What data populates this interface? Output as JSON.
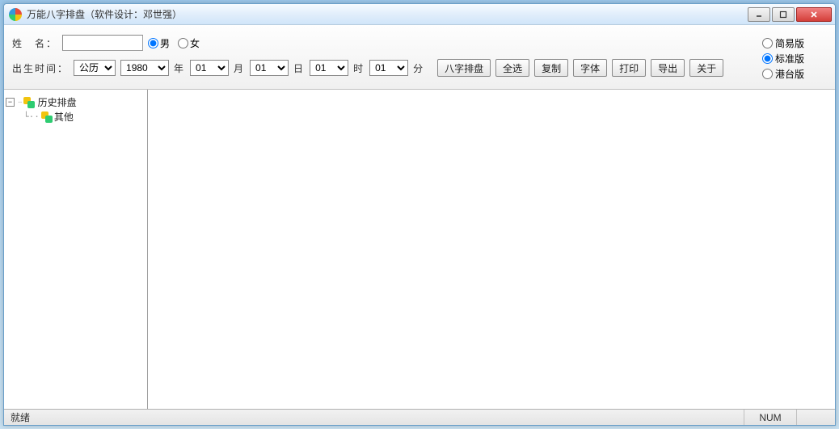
{
  "window": {
    "title": "万能八字排盘（软件设计：邓世强）"
  },
  "toolbar": {
    "nameLabel": "姓　名：",
    "nameValue": "",
    "gender": {
      "male": "男",
      "female": "女",
      "selected": "male"
    },
    "birthLabel": "出生时间：",
    "calendar": {
      "selected": "公历"
    },
    "year": {
      "selected": "1980",
      "unit": "年"
    },
    "month": {
      "selected": "01",
      "unit": "月"
    },
    "day": {
      "selected": "01",
      "unit": "日"
    },
    "hour": {
      "selected": "01",
      "unit": "时"
    },
    "minute": {
      "selected": "01",
      "unit": "分"
    },
    "buttons": {
      "paipan": "八字排盘",
      "selectAll": "全选",
      "copy": "复制",
      "font": "字体",
      "print": "打印",
      "export": "导出",
      "about": "关于"
    },
    "versions": {
      "simple": "简易版",
      "standard": "标准版",
      "gangtai": "港台版",
      "selected": "standard"
    }
  },
  "tree": {
    "root": {
      "label": "历史排盘"
    },
    "child": {
      "label": "其他"
    }
  },
  "statusbar": {
    "ready": "就绪",
    "num": "NUM"
  }
}
